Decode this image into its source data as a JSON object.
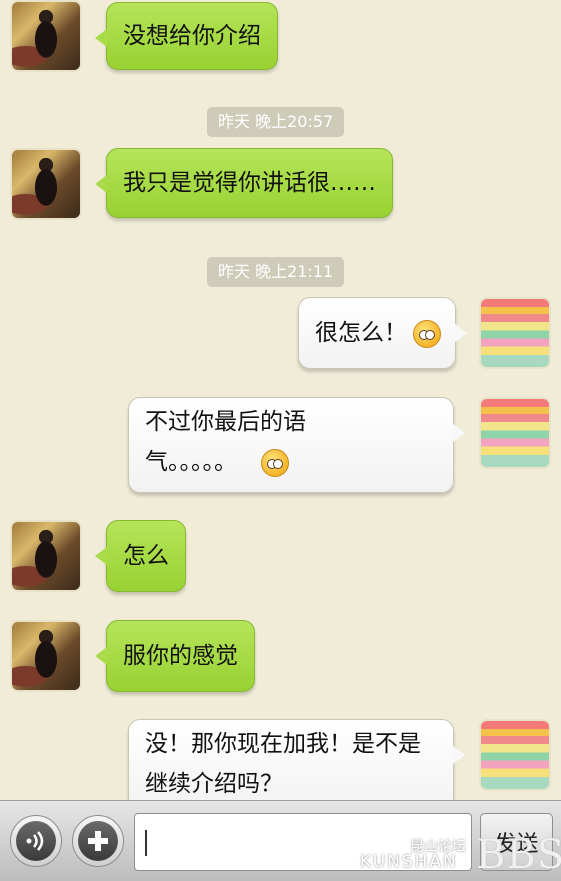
{
  "messages": [
    {
      "side": "friend",
      "text": "没想给你介绍"
    },
    {
      "timestamp": "昨天 晚上20:57"
    },
    {
      "side": "friend",
      "text": "我只是觉得你讲话很……"
    },
    {
      "timestamp": "昨天 晚上21:11"
    },
    {
      "side": "me",
      "text": "很怎么！",
      "emoji": "angry-face-icon"
    },
    {
      "side": "me",
      "line1": "不过你最后的语",
      "line2": "气。。。。。",
      "emoji": "rolling-eyes-icon"
    },
    {
      "side": "friend",
      "text": "怎么"
    },
    {
      "side": "friend",
      "text": "服你的感觉"
    },
    {
      "side": "me",
      "line1": "没！那你现在加我！是不是",
      "line2": "继续介绍吗？"
    }
  ],
  "input_bar": {
    "voice_icon": "voice-waves-icon",
    "plus_icon": "plus-icon",
    "input_value": "",
    "send_label": "发送"
  },
  "watermark": {
    "site_cn": "昆山论坛",
    "site_en": "KUNSHAN",
    "bbs": "BBS"
  },
  "colors": {
    "background": "#f0ecd8",
    "friend_bubble": "#a8dc48",
    "my_bubble": "#ffffff",
    "timestamp_bg": "#cfcbb9"
  }
}
